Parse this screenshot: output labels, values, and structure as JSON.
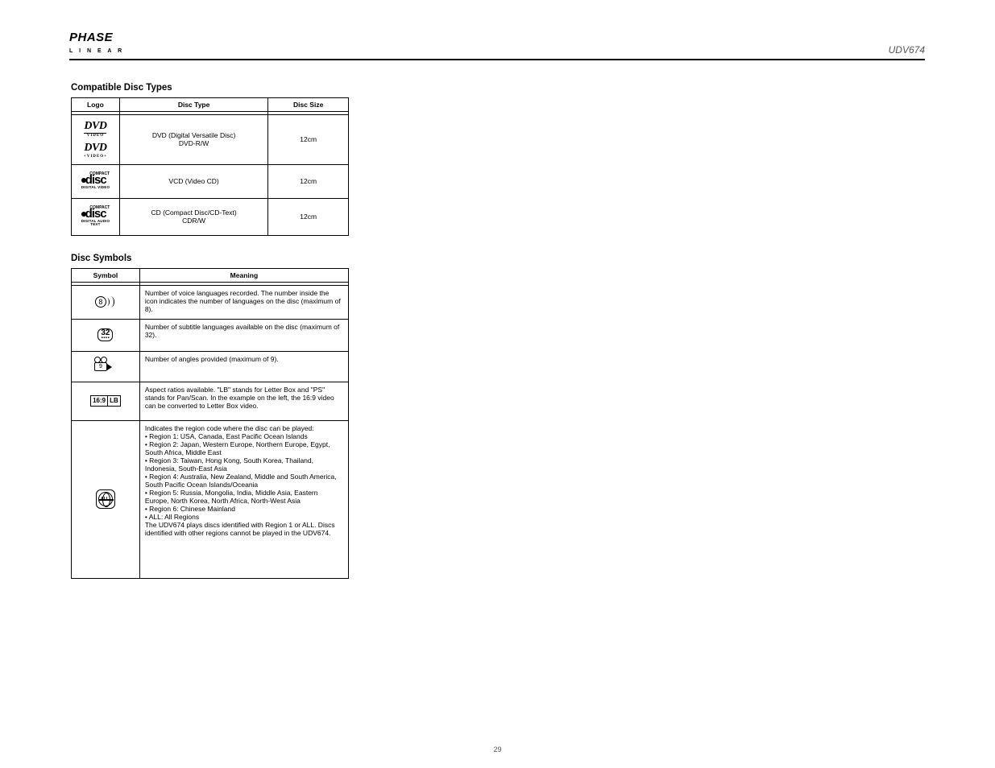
{
  "logo": {
    "line1": "PHASE",
    "line2": "L I N E A R"
  },
  "header_right": "UDV674",
  "section1_title": "Compatible Disc Types",
  "table1": {
    "headers": [
      "Logo",
      "Disc Type",
      "Disc Size"
    ],
    "rows": [
      {
        "type": "DVD (Digital Versatile Disc)\nDVD-R/W",
        "size": "12cm"
      },
      {
        "type": "VCD (Video CD)",
        "size": "12cm"
      },
      {
        "type": "CD (Compact Disc/CD-Text)\nCDR/W",
        "size": "12cm"
      }
    ]
  },
  "section2_title": "Disc Symbols",
  "table2": {
    "headers": [
      "Symbol",
      "Meaning"
    ],
    "rows": [
      {
        "meaning": "Number of voice languages recorded. The number inside the icon indicates the number of languages on the disc (maximum of 8)."
      },
      {
        "meaning": "Number of subtitle languages available on the disc (maximum of 32)."
      },
      {
        "meaning": "Number of angles provided (maximum of 9)."
      },
      {
        "meaning": "Aspect ratios available. \"LB\" stands for Letter Box and \"PS\" stands for Pan/Scan. In the example on the left, the 16:9 video can be converted to Letter Box video."
      },
      {
        "meaning": "Indicates the region code where the disc can be played:\n• Region 1: USA, Canada, East Pacific Ocean Islands\n• Region 2: Japan, Western Europe, Northern Europe, Egypt, South Africa, Middle East\n• Region 3: Taiwan, Hong Kong, South Korea, Thailand, Indonesia, South-East Asia\n• Region 4: Australia, New Zealand, Middle and South America, South Pacific Ocean Islands/Oceania\n• Region 5: Russia, Mongolia, India, Middle Asia, Eastern Europe, North Korea, North Africa, North-West Asia\n• Region 6: Chinese Mainland\n• ALL: All Regions\nThe UDV674 plays discs identified with Region 1 or ALL. Discs identified with other regions cannot be played in the UDV674."
      }
    ]
  },
  "icon_labels": {
    "dvd_sub": "VIDEO",
    "disc_compact": "COMPACT",
    "disc_dv_sub": "DIGITAL VIDEO",
    "disc_da_sub1": "DIGITAL AUDIO",
    "disc_da_sub2": "TEXT",
    "sound_num": "8",
    "subtitle_num": "32",
    "camera_num": "9",
    "aspect_main": "16:9",
    "aspect_lb": "LB",
    "region_all": "ALL"
  },
  "page_number": "29"
}
